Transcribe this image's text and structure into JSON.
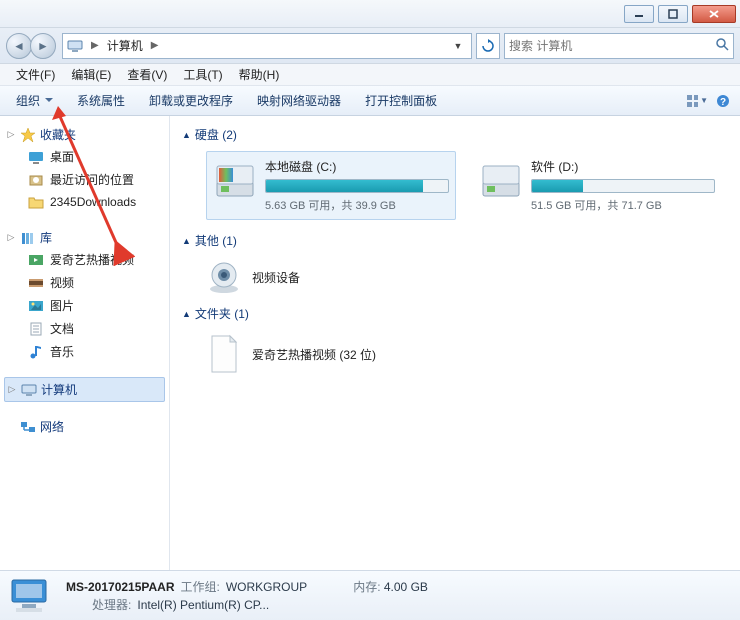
{
  "window": {
    "min": "_",
    "max": "☐",
    "close": "✕"
  },
  "address": {
    "root_label": "计算机",
    "search_placeholder": "搜索 计算机"
  },
  "menubar": {
    "file": "文件(F)",
    "edit": "编辑(E)",
    "view": "查看(V)",
    "tools": "工具(T)",
    "help": "帮助(H)"
  },
  "toolbar": {
    "organize": "组织",
    "system_properties": "系统属性",
    "uninstall": "卸载或更改程序",
    "map_drive": "映射网络驱动器",
    "control_panel": "打开控制面板"
  },
  "sidebar": {
    "favorites": {
      "label": "收藏夹",
      "items": [
        "桌面",
        "最近访问的位置",
        "2345Downloads"
      ]
    },
    "libraries": {
      "label": "库",
      "items": [
        "爱奇艺热播视频",
        "视频",
        "图片",
        "文档",
        "音乐"
      ]
    },
    "computer": {
      "label": "计算机"
    },
    "network": {
      "label": "网络"
    }
  },
  "content": {
    "sections": {
      "hdd": {
        "label": "硬盘 (2)"
      },
      "other": {
        "label": "其他 (1)"
      },
      "folders": {
        "label": "文件夹 (1)"
      }
    },
    "drives": [
      {
        "name": "本地磁盘 (C:)",
        "free": "5.63 GB 可用，共 39.9 GB",
        "fill_pct": 86,
        "selected": true
      },
      {
        "name": "软件 (D:)",
        "free": "51.5 GB 可用，共 71.7 GB",
        "fill_pct": 28,
        "selected": false
      }
    ],
    "other_device": {
      "name": "视频设备"
    },
    "folder_item": {
      "name": "爱奇艺热播视频 (32 位)"
    }
  },
  "statusbar": {
    "computer_name": "MS-20170215PAAR",
    "workgroup_label": "工作组:",
    "workgroup": "WORKGROUP",
    "processor_label": "处理器:",
    "processor": "Intel(R) Pentium(R) CP...",
    "memory_label": "内存:",
    "memory": "4.00 GB"
  }
}
